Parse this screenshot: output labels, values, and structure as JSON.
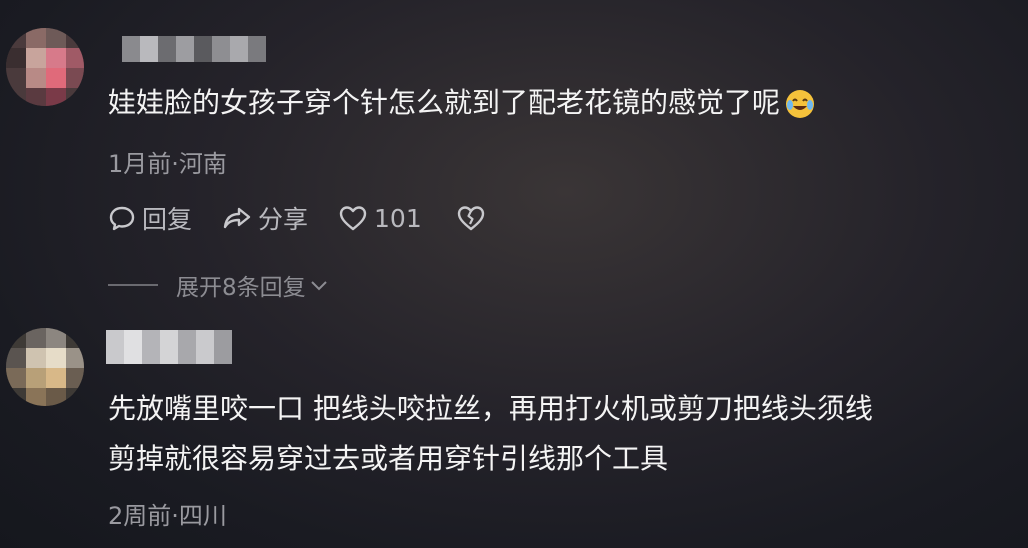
{
  "comments": [
    {
      "text": "娃娃脸的女孩子穿个针怎么就到了配老花镜的感觉了呢",
      "emoji": "laughing-crying-emoji",
      "meta": "1月前·河南",
      "reply_label": "回复",
      "share_label": "分享",
      "like_count": "101",
      "expand_label": "展开8条回复"
    },
    {
      "text_line1": "先放嘴里咬一口 把线头咬拉丝，再用打火机或剪刀把线头须线",
      "text_line2": "剪掉就很容易穿过去或者用穿针引线那个工具",
      "meta": "2周前·四川"
    }
  ],
  "colors": {
    "text": "#f4f4f4",
    "meta": "#9a9aa0",
    "action": "#b9b9be"
  }
}
